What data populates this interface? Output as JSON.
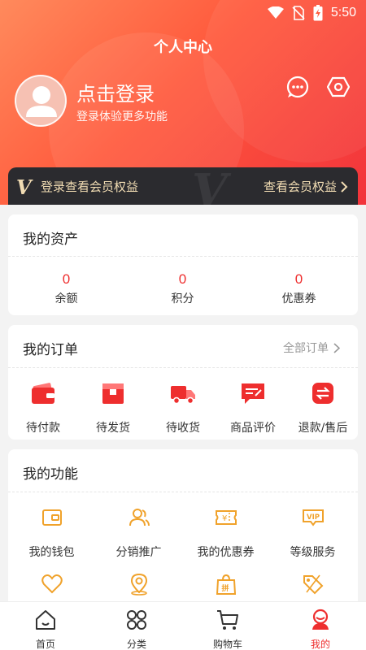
{
  "status_bar": {
    "time": "5:50",
    "icons": [
      "wifi-icon",
      "no-sim-icon",
      "battery-icon"
    ]
  },
  "header": {
    "title": "个人中心"
  },
  "profile": {
    "login_title": "点击登录",
    "login_subtitle": "登录体验更多功能",
    "icons": [
      "message-icon",
      "settings-icon"
    ]
  },
  "vip": {
    "logo": "V",
    "left_text": "登录查看会员权益",
    "right_text": "查看会员权益"
  },
  "assets": {
    "title": "我的资产",
    "items": [
      {
        "value": "0",
        "label": "余额"
      },
      {
        "value": "0",
        "label": "积分"
      },
      {
        "value": "0",
        "label": "优惠券"
      }
    ]
  },
  "orders": {
    "title": "我的订单",
    "all_label": "全部订单",
    "items": [
      {
        "label": "待付款",
        "icon": "wallet-icon"
      },
      {
        "label": "待发货",
        "icon": "package-icon"
      },
      {
        "label": "待收货",
        "icon": "truck-icon"
      },
      {
        "label": "商品评价",
        "icon": "review-icon"
      },
      {
        "label": "退款/售后",
        "icon": "refund-icon"
      }
    ]
  },
  "functions": {
    "title": "我的功能",
    "items": [
      {
        "label": "我的钱包",
        "icon": "wallet-outline-icon"
      },
      {
        "label": "分销推广",
        "icon": "users-icon"
      },
      {
        "label": "我的优惠券",
        "icon": "coupon-icon"
      },
      {
        "label": "等级服务",
        "icon": "vip-badge-icon"
      },
      {
        "label": "",
        "icon": "heart-icon"
      },
      {
        "label": "",
        "icon": "location-icon"
      },
      {
        "label": "",
        "icon": "group-buy-bag-icon"
      },
      {
        "label": "",
        "icon": "tag-icon"
      }
    ]
  },
  "tabbar": {
    "items": [
      {
        "label": "首页",
        "icon": "home-icon",
        "active": false
      },
      {
        "label": "分类",
        "icon": "category-icon",
        "active": false
      },
      {
        "label": "购物车",
        "icon": "cart-icon",
        "active": false
      },
      {
        "label": "我的",
        "icon": "profile-icon",
        "active": true
      }
    ]
  },
  "colors": {
    "accent": "#ee2e2e",
    "gradient_start": "#ff8a5c",
    "gradient_end": "#f2333b",
    "vip_bg": "#2b2b2f",
    "vip_text": "#f1dcb3",
    "function_icon": "#f0a22b"
  }
}
